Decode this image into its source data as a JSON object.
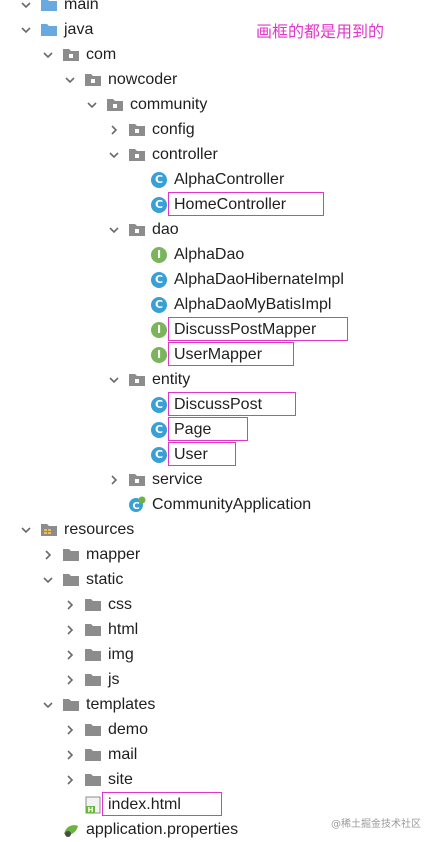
{
  "annotation": "画框的都是用到的",
  "watermark": "@稀土掘金技术社区",
  "tree": [
    {
      "label": "main",
      "expanded": true,
      "kind": "folder-blue"
    },
    {
      "label": "java",
      "expanded": true,
      "kind": "folder-blue"
    },
    {
      "label": "com",
      "expanded": true,
      "kind": "package"
    },
    {
      "label": "nowcoder",
      "expanded": true,
      "kind": "package"
    },
    {
      "label": "community",
      "expanded": true,
      "kind": "package"
    },
    {
      "label": "config",
      "expanded": false,
      "kind": "package"
    },
    {
      "label": "controller",
      "expanded": true,
      "kind": "package"
    },
    {
      "label": "AlphaController",
      "kind": "class"
    },
    {
      "label": "HomeController",
      "kind": "class",
      "highlight": true
    },
    {
      "label": "dao",
      "expanded": true,
      "kind": "package"
    },
    {
      "label": "AlphaDao",
      "kind": "interface"
    },
    {
      "label": "AlphaDaoHibernateImpl",
      "kind": "class"
    },
    {
      "label": "AlphaDaoMyBatisImpl",
      "kind": "class"
    },
    {
      "label": "DiscussPostMapper",
      "kind": "interface",
      "highlight": true
    },
    {
      "label": "UserMapper",
      "kind": "interface",
      "highlight": true
    },
    {
      "label": "entity",
      "expanded": true,
      "kind": "package"
    },
    {
      "label": "DiscussPost",
      "kind": "class",
      "highlight": true
    },
    {
      "label": "Page",
      "kind": "class",
      "highlight": true
    },
    {
      "label": "User",
      "kind": "class",
      "highlight": true
    },
    {
      "label": "service",
      "expanded": false,
      "kind": "package"
    },
    {
      "label": "CommunityApplication",
      "kind": "spring-class"
    },
    {
      "label": "resources",
      "expanded": true,
      "kind": "resources"
    },
    {
      "label": "mapper",
      "expanded": false,
      "kind": "folder"
    },
    {
      "label": "static",
      "expanded": true,
      "kind": "folder"
    },
    {
      "label": "css",
      "expanded": false,
      "kind": "folder"
    },
    {
      "label": "html",
      "expanded": false,
      "kind": "folder"
    },
    {
      "label": "img",
      "expanded": false,
      "kind": "folder"
    },
    {
      "label": "js",
      "expanded": false,
      "kind": "folder"
    },
    {
      "label": "templates",
      "expanded": true,
      "kind": "folder"
    },
    {
      "label": "demo",
      "expanded": false,
      "kind": "folder"
    },
    {
      "label": "mail",
      "expanded": false,
      "kind": "folder"
    },
    {
      "label": "site",
      "expanded": false,
      "kind": "folder"
    },
    {
      "label": "index.html",
      "kind": "html",
      "highlight": true
    },
    {
      "label": "application.properties",
      "kind": "properties"
    }
  ],
  "colors": {
    "highlight": "#e236c8",
    "class_icon": "#38a0d7",
    "interface_icon": "#7ab55c",
    "folder_blue": "#6aa8e0",
    "folder_gray": "#8c8c8c"
  }
}
